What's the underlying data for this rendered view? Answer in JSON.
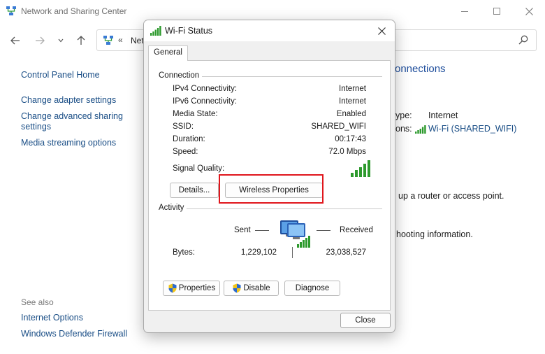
{
  "window": {
    "title": "Network and Sharing Center",
    "address_chevron": "«",
    "address_text": "Net"
  },
  "left_pane": {
    "links": [
      "Control Panel Home",
      "Change adapter settings",
      "Change advanced sharing settings",
      "Media streaming options"
    ],
    "see_also_label": "See also",
    "see_also_links": [
      "Internet Options",
      "Windows Defender Firewall"
    ]
  },
  "right_pane": {
    "heading_fragment": "onnections",
    "access_type_fragment": "ype:",
    "access_type_value": "Internet",
    "connections_fragment": "ons:",
    "connections_value": "Wi-Fi (SHARED_WIFI)",
    "router_text_fragment": "up a router or access point.",
    "troubleshoot_fragment": "hooting information."
  },
  "dialog": {
    "title": "Wi-Fi Status",
    "close_glyph": "✕",
    "tab_label": "General",
    "connection_label": "Connection",
    "rows": [
      {
        "label": "IPv4 Connectivity:",
        "value": "Internet"
      },
      {
        "label": "IPv6 Connectivity:",
        "value": "Internet"
      },
      {
        "label": "Media State:",
        "value": "Enabled"
      },
      {
        "label": "SSID:",
        "value": "SHARED_WIFI"
      },
      {
        "label": "Duration:",
        "value": "00:17:43"
      },
      {
        "label": "Speed:",
        "value": "72.0 Mbps"
      }
    ],
    "signal_quality_label": "Signal Quality:",
    "signal_bars_lit": 5,
    "details_button": "Details...",
    "wireless_properties_button": "Wireless Properties",
    "activity_label": "Activity",
    "sent_label": "Sent",
    "received_label": "Received",
    "bytes_label": "Bytes:",
    "bytes_sent": "1,229,102",
    "bytes_received": "23,038,527",
    "properties_button": "Properties",
    "disable_button": "Disable",
    "diagnose_button": "Diagnose",
    "close_button": "Close",
    "highlight_color": "#e0161c"
  },
  "colors": {
    "link": "#1a4e86",
    "heading": "#1f4e9c",
    "signal_green": "#2d9a2d"
  },
  "icons": [
    "network-center-icon",
    "back-arrow-icon",
    "forward-arrow-icon",
    "chevron-down-icon",
    "up-arrow-icon",
    "search-icon",
    "wifi-signal-icon",
    "shield-icon",
    "computers-icon",
    "close-icon"
  ]
}
